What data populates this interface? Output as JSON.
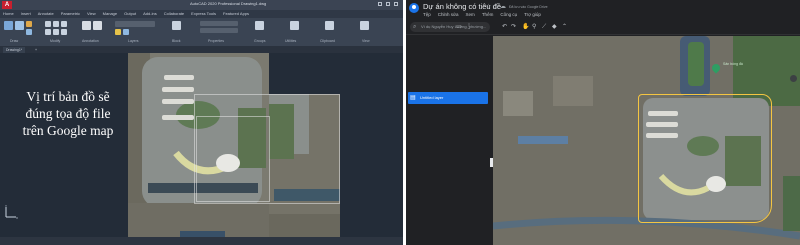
{
  "cad": {
    "app_logo": "A",
    "title": "AutoCAD 2020 Professional  Drawing1.dwg",
    "menus": [
      "Home",
      "Insert",
      "Annotate",
      "Parametric",
      "View",
      "Manage",
      "Output",
      "Add-ins",
      "Collaborate",
      "Express Tools",
      "Featured Apps"
    ],
    "ribbon_groups": [
      "Draw",
      "Modify",
      "Annotation",
      "Layers",
      "Block",
      "Properties",
      "Groups",
      "Utilities",
      "Clipboard",
      "View"
    ],
    "file_tab": "Drawing1*",
    "annotation_text": "Vị trí bản đồ sẽ đúng tọa độ file trên Google map"
  },
  "gmaps": {
    "map_title": "Dự án không có tiêu đề",
    "saved_status": "Đã lưu vào Google Drive",
    "menus": [
      "Tệp",
      "Chỉnh sửa",
      "Xem",
      "Thêm",
      "Công cụ",
      "Trợ giúp"
    ],
    "search_placeholder": "Ví dụ Nguyễn Huy Lượng, phường...",
    "layer_name": "Untitled layer",
    "poi_label": "Sân bóng đá"
  },
  "colors": {
    "cad_background": "#232c38",
    "map_boundary": "#f4c542",
    "layer_highlight": "#1a73e8",
    "app_logo_red": "#c8202f"
  },
  "icons": {
    "search": "search-icon",
    "folder": "folder-icon",
    "star": "star-icon",
    "layer": "layer-icon",
    "pin": "map-pin-icon"
  }
}
